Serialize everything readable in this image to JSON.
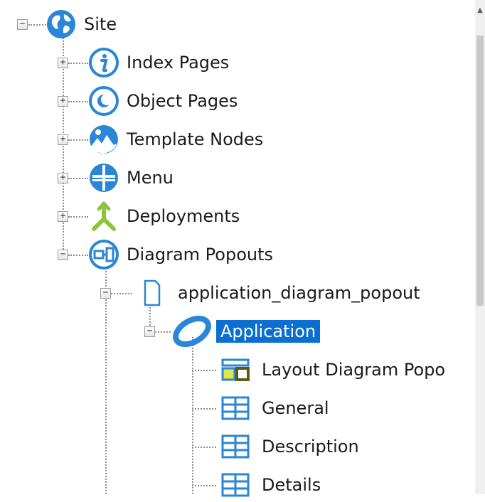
{
  "tree": {
    "nodes": [
      {
        "label": "Site",
        "icon": "globe-icon",
        "expanded": true
      },
      {
        "label": "Index Pages",
        "icon": "info-icon",
        "expanded": false
      },
      {
        "label": "Object Pages",
        "icon": "moon-icon",
        "expanded": false
      },
      {
        "label": "Template Nodes",
        "icon": "landscape-icon",
        "expanded": false
      },
      {
        "label": "Menu",
        "icon": "menu-icon",
        "expanded": false
      },
      {
        "label": "Deployments",
        "icon": "deployment-icon",
        "expanded": false
      },
      {
        "label": "Diagram Popouts",
        "icon": "diagram-icon",
        "expanded": true
      },
      {
        "label": "application_diagram_popout",
        "icon": "page-icon",
        "expanded": true
      },
      {
        "label": "Application",
        "icon": "ring-icon",
        "expanded": true,
        "selected": true
      },
      {
        "label": "Layout Diagram Popo",
        "icon": "layout-icon"
      },
      {
        "label": "General",
        "icon": "form-icon"
      },
      {
        "label": "Description",
        "icon": "form-icon"
      },
      {
        "label": "Details",
        "icon": "form-icon"
      }
    ],
    "expand_glyph": "+",
    "collapse_glyph": "−"
  },
  "colors": {
    "selection": "#0a6fd0",
    "icon_blue": "#2a86d6",
    "deployment_green": "#8cc43c"
  }
}
